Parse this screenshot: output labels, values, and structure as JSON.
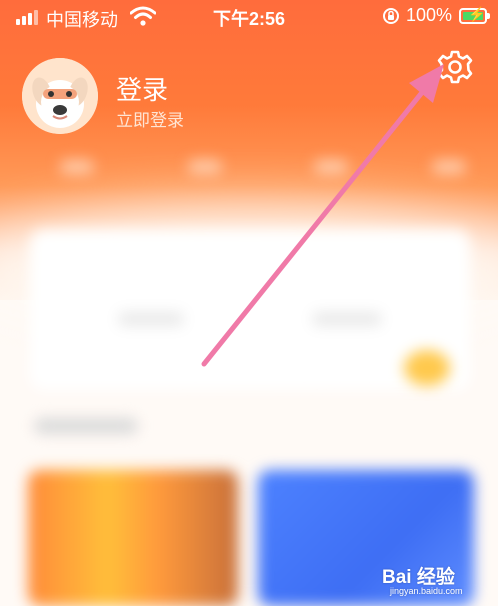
{
  "status_bar": {
    "carrier": "中国移动",
    "time": "下午2:56",
    "battery_percent": "100%",
    "battery_level": 1.0,
    "charging": true,
    "icons": [
      "signal-icon",
      "wifi-icon",
      "rotation-lock-icon",
      "battery-icon"
    ]
  },
  "profile": {
    "title": "登录",
    "subtitle": "立即登录",
    "avatar_icon": "dog-avatar"
  },
  "header": {
    "settings_icon": "gear-icon"
  },
  "annotation": {
    "arrow_color": "#f07aa8",
    "points_to": "settings-button"
  },
  "watermark": {
    "logo_text": "Bai 经验",
    "site": "jingyan.baidu.com"
  },
  "colors": {
    "header_orange": "#ff6c3c",
    "arrow_pink": "#f07aa8",
    "card_blue": "#4d82ff",
    "coin_yellow": "#ffc94d"
  }
}
